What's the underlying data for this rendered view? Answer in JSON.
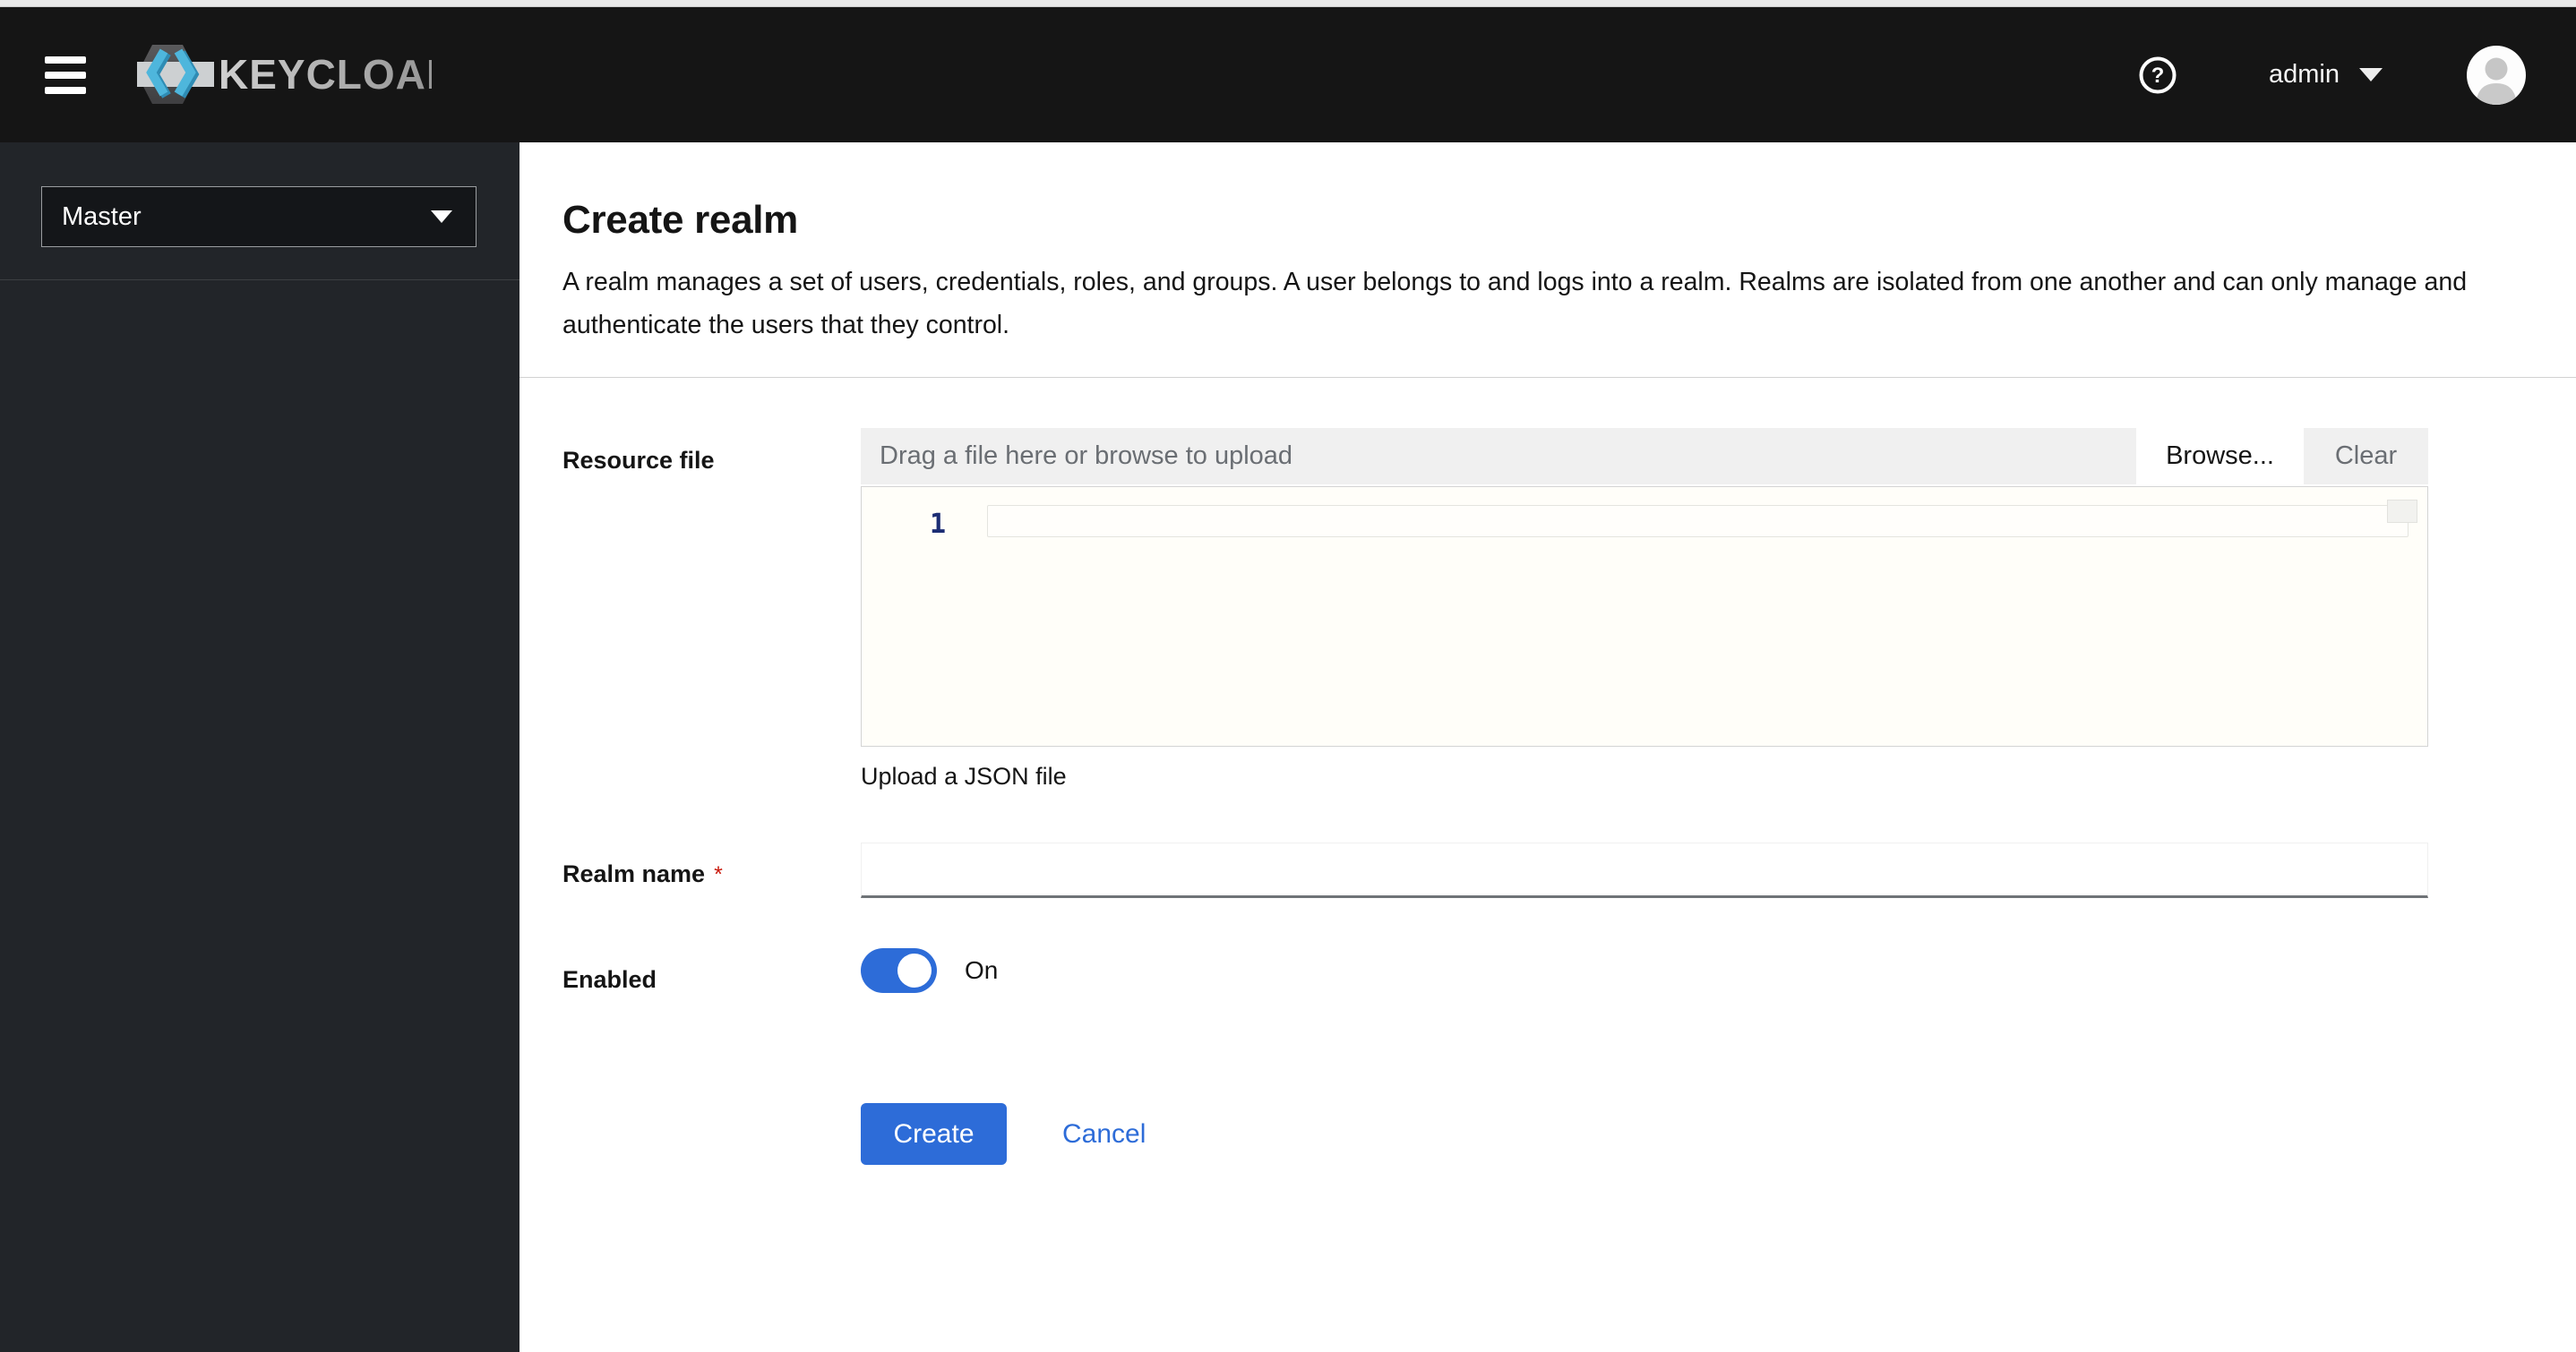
{
  "header": {
    "brand": "KEYCLOAK",
    "username": "admin"
  },
  "sidebar": {
    "realm_selector": {
      "value": "Master"
    }
  },
  "page": {
    "title": "Create realm",
    "description": "A realm manages a set of users, credentials, roles, and groups. A user belongs to and logs into a realm. Realms are isolated from one another and can only manage and authenticate the users that they control."
  },
  "form": {
    "resource_file": {
      "label": "Resource file",
      "placeholder": "Drag a file here or browse to upload",
      "browse_label": "Browse...",
      "clear_label": "Clear",
      "editor_line_number": "1",
      "helper_text": "Upload a JSON file"
    },
    "realm_name": {
      "label": "Realm name",
      "required_indicator": "*",
      "value": ""
    },
    "enabled": {
      "label": "Enabled",
      "state_label": "On"
    },
    "actions": {
      "create_label": "Create",
      "cancel_label": "Cancel"
    }
  },
  "colors": {
    "primary": "#2d6cd8",
    "danger": "#c9190b",
    "masthead_bg": "#151515",
    "sidebar_bg": "#222529",
    "dragbar_bg": "#f0f0f0"
  }
}
